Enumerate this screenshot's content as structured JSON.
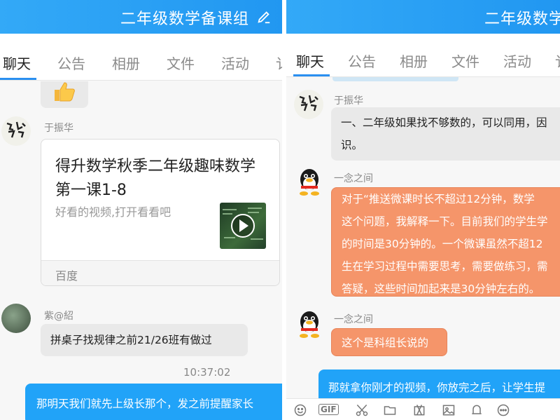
{
  "left": {
    "header": {
      "title": "二年级数学备课组"
    },
    "tabs": [
      "聊天",
      "公告",
      "相册",
      "文件",
      "活动",
      "讠"
    ],
    "messages": {
      "card": {
        "sender": "于振华",
        "title": "得升数学秋季二年级趣味数学第一课1-8",
        "desc": "好看的视频,打开看看吧",
        "source": "百度"
      },
      "msg2": {
        "sender": "紫@紹",
        "text": "拼桌子找规律之前21/26班有做过"
      },
      "time": "10:37:02",
      "msg3": {
        "text": "那明天我们就先上级长那个，发之前提醒家长"
      }
    }
  },
  "right": {
    "header": {
      "title": "二年级数学备课组"
    },
    "tabs": [
      "聊天",
      "公告",
      "相册",
      "文件",
      "活动",
      "讠"
    ],
    "messages": {
      "m1": {
        "sender": "于振华",
        "line1": "一、二年级如果找不够数的，可以同用，因",
        "line2": "识。"
      },
      "m2": {
        "sender": "一念之间",
        "lines": [
          "对于“推送微课时长不超过12分钟，数学",
          "这个问题，我解释一下。目前我们的学生学",
          "的时间是30分钟的。一个微课虽然不超12",
          "生在学习过程中需要思考，需要做练习，需",
          "答疑，这些时间加起来是30分钟左右的。"
        ]
      },
      "m3": {
        "sender": "一念之间",
        "text": "这个是科组长说的"
      },
      "m4": {
        "text": "那就拿你刚才的视频，你放完之后，让学生提"
      }
    },
    "toolbar": {
      "gif_label": "GIF",
      "icons": [
        "emoji-icon",
        "gif-icon",
        "scissors-icon",
        "folder-icon",
        "photo-edit-icon",
        "image-icon",
        "bell-icon",
        "more-icon"
      ]
    }
  },
  "colors": {
    "header": "#2a9ff3",
    "orange_bubble": "#f5956a",
    "blue_bubble": "#21a3f8",
    "tab_active_line": "#2a8ff0"
  }
}
